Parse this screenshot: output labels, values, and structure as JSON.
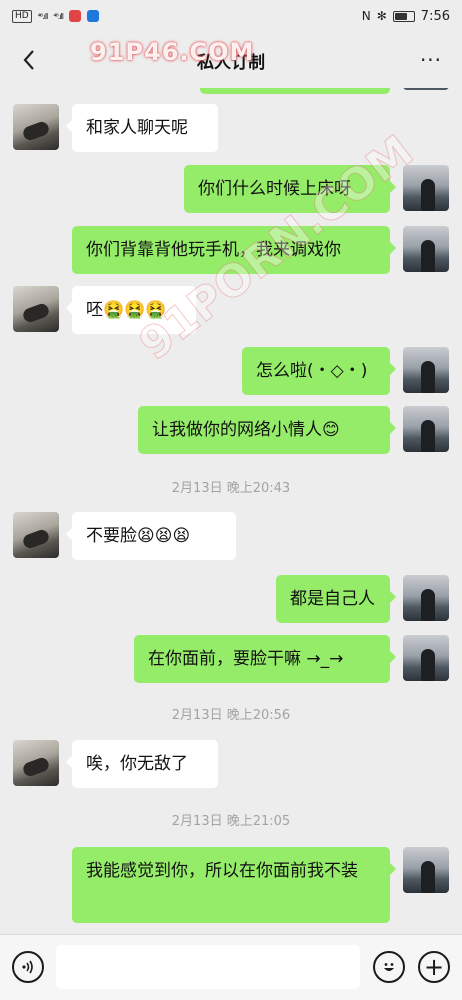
{
  "status_bar": {
    "hd_label": "HD",
    "signal1": "⁴⁶.ıll",
    "signal2": "⁴⁶.ıll",
    "time": "7:56",
    "nfc": "N",
    "bluetooth": "✻",
    "battery_level": 0.65,
    "app_colors": [
      "#e04545",
      "#1e78e0"
    ]
  },
  "header": {
    "title": "私人订制",
    "back_icon": "chevron-left-icon",
    "more_icon": "more-dots-icon",
    "more_label": "···"
  },
  "watermark": {
    "text_top": "91P46.COM",
    "text_diagonal": "91PORN.COM"
  },
  "messages": [
    {
      "side": "left",
      "text": "和家人聊天呢"
    },
    {
      "side": "right",
      "text": "你们什么时候上床呀"
    },
    {
      "side": "right",
      "text": "你们背靠背他玩手机，我来调戏你"
    },
    {
      "side": "left",
      "text": "呸🤮🤮🤮"
    },
    {
      "side": "right",
      "text": "怎么啦(・◇・)"
    },
    {
      "side": "right",
      "text": "让我做你的网络小情人😊"
    },
    {
      "type": "time",
      "text": "2月13日 晚上20:43"
    },
    {
      "side": "left",
      "text": "不要脸😫😫😫"
    },
    {
      "side": "right",
      "text": "都是自己人"
    },
    {
      "side": "right",
      "text": "在你面前，要脸干嘛 →_→"
    },
    {
      "type": "time",
      "text": "2月13日 晚上20:56"
    },
    {
      "side": "left",
      "text": "唉，你无敌了"
    },
    {
      "type": "time",
      "text": "2月13日 晚上21:05"
    },
    {
      "side": "right",
      "text": "我能感觉到你，所以在你面前我不装"
    }
  ],
  "input_bar": {
    "voice_icon": "voice-icon",
    "emoji_icon": "emoji-icon",
    "plus_icon": "plus-icon",
    "plus_label": "+",
    "input_value": ""
  },
  "colors": {
    "background": "#ededed",
    "bubble_self": "#95ec69",
    "bubble_other": "#ffffff",
    "timestamp": "#a3a3a3"
  }
}
